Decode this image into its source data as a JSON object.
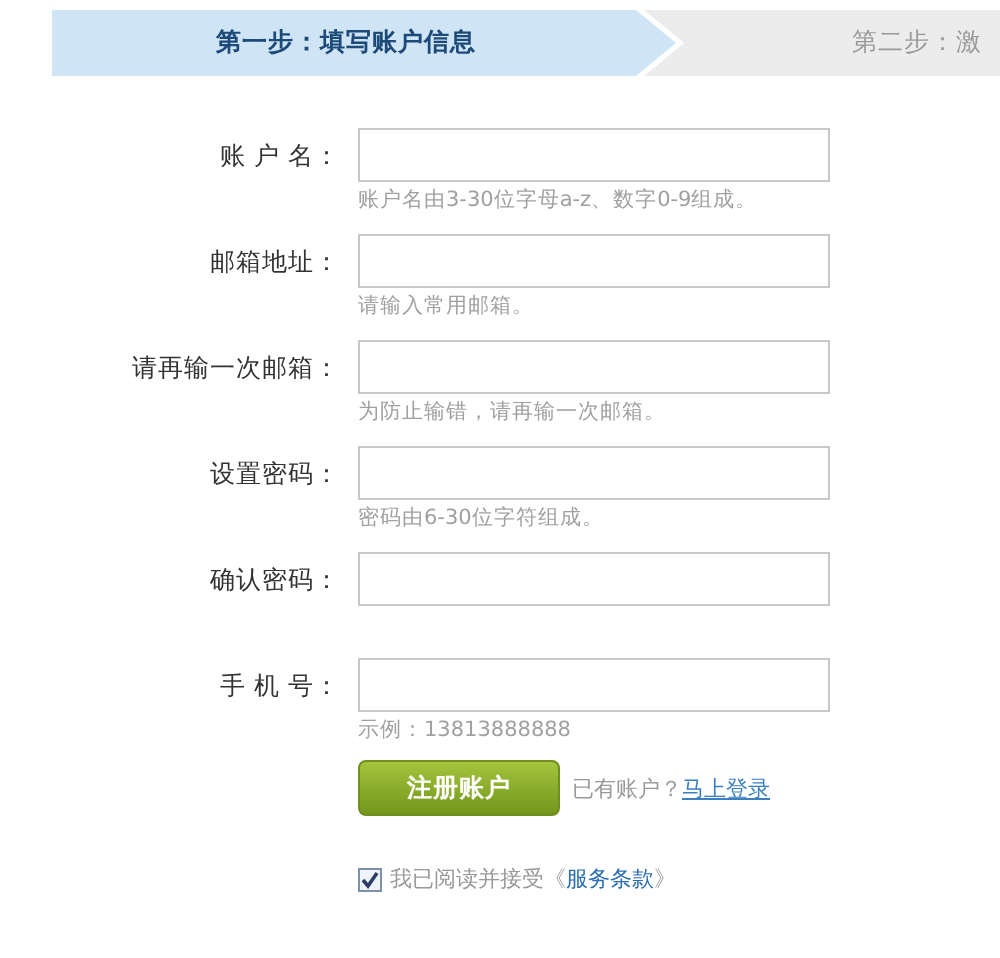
{
  "steps": [
    {
      "label": "第一步：填写账户信息",
      "selected": true
    },
    {
      "label": "第二步：激",
      "selected": false
    }
  ],
  "fields": [
    {
      "label": "账 户 名：",
      "hint": "账户名由3-30位字母a-z、数字0-9组成。"
    },
    {
      "label": "邮箱地址：",
      "hint": "请输入常用邮箱。"
    },
    {
      "label": "请再输一次邮箱：",
      "hint": "为防止输错，请再输一次邮箱。"
    },
    {
      "label": "设置密码：",
      "hint": "密码由6-30位字符组成。"
    },
    {
      "label": "确认密码："
    },
    {
      "label": "手 机 号：",
      "hint": "示例：13813888888"
    }
  ],
  "submit": {
    "label": "注册账户"
  },
  "login_prompt": {
    "text": "已有账户？",
    "link": "马上登录"
  },
  "terms": {
    "checked": true,
    "text_before": "我已阅读并接受《",
    "link": "服务条款",
    "text_after": "》"
  }
}
